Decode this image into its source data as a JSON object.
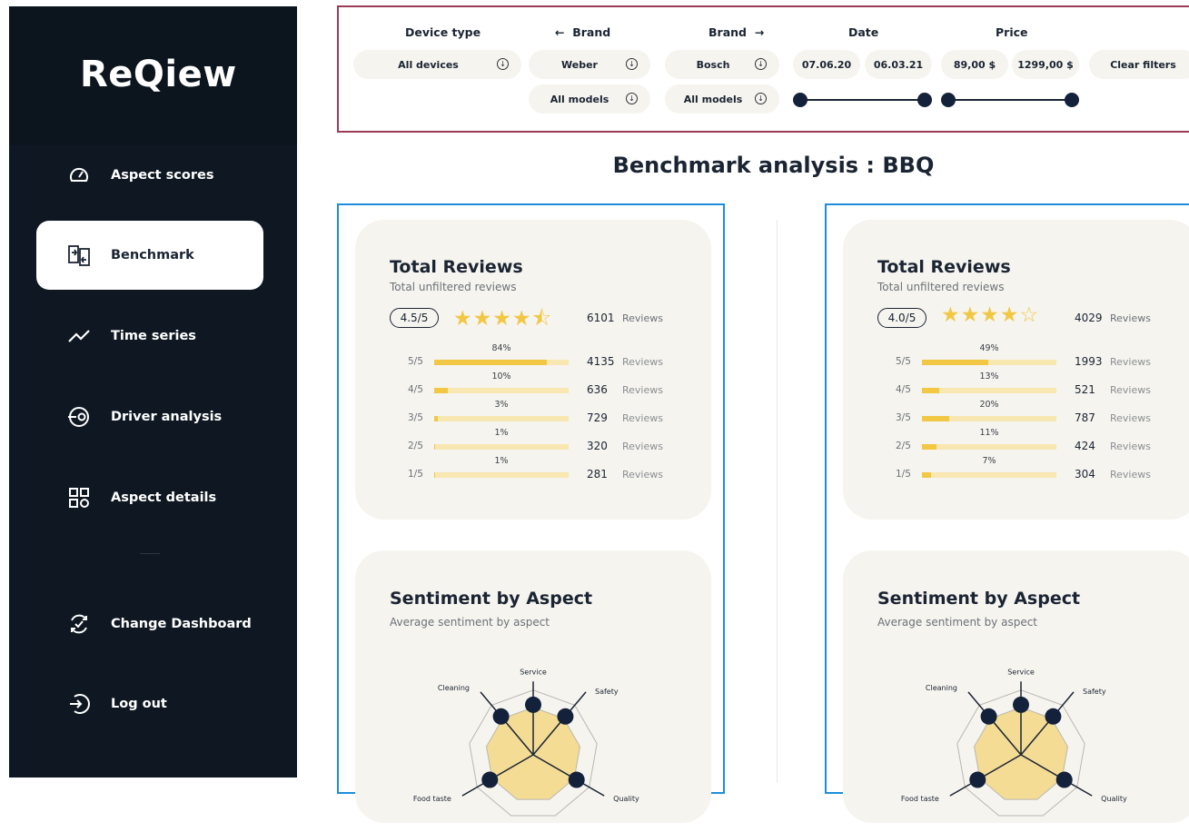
{
  "app": {
    "name": "ReQiew"
  },
  "sidebar": {
    "items": [
      {
        "label": "Aspect scores",
        "icon": "gauge-icon",
        "active": false
      },
      {
        "label": "Benchmark",
        "icon": "compare-icon",
        "active": true
      },
      {
        "label": "Time series",
        "icon": "trend-line-icon",
        "active": false
      },
      {
        "label": "Driver analysis",
        "icon": "target-icon",
        "active": false
      },
      {
        "label": "Aspect details",
        "icon": "grid-icon",
        "active": false
      }
    ],
    "bottom_items": [
      {
        "label": "Change Dashboard",
        "icon": "sync-icon"
      },
      {
        "label": "Log out",
        "icon": "logout-icon"
      }
    ]
  },
  "filters": {
    "device_type": {
      "label": "Device type",
      "value": "All devices"
    },
    "brand_left": {
      "label": "Brand",
      "arrow": "←",
      "brand": "Weber",
      "model": "All models"
    },
    "brand_right": {
      "label": "Brand",
      "arrow": "→",
      "brand": "Bosch",
      "model": "All models"
    },
    "date": {
      "label": "Date",
      "from": "07.06.20",
      "to": "06.03.21"
    },
    "price": {
      "label": "Price",
      "from": "89,00 $",
      "to": "1299,00 $"
    },
    "clear_label": "Clear filters"
  },
  "page": {
    "title": "Benchmark analysis : BBQ"
  },
  "panels": [
    {
      "total_reviews": {
        "title": "Total Reviews",
        "subtitle": "Total unfiltered reviews",
        "score": "4.5/5",
        "stars": "★★★★⯪",
        "rating": 4.5,
        "total": "6101",
        "total_label": "Reviews",
        "rows": [
          {
            "level": "5/5",
            "pct": "84%",
            "fraction": 0.84,
            "count": "4135",
            "label": "Reviews"
          },
          {
            "level": "4/5",
            "pct": "10%",
            "fraction": 0.1,
            "count": "636",
            "label": "Reviews"
          },
          {
            "level": "3/5",
            "pct": "3%",
            "fraction": 0.03,
            "count": "729",
            "label": "Reviews"
          },
          {
            "level": "2/5",
            "pct": "1%",
            "fraction": 0.01,
            "count": "320",
            "label": "Reviews"
          },
          {
            "level": "1/5",
            "pct": "1%",
            "fraction": 0.01,
            "count": "281",
            "label": "Reviews"
          }
        ]
      },
      "sentiment": {
        "title": "Sentiment by Aspect",
        "subtitle": "Average sentiment by aspect",
        "aspects": [
          "Service",
          "Safety",
          "Quality",
          "Food taste",
          "Cleaning"
        ]
      }
    },
    {
      "total_reviews": {
        "title": "Total Reviews",
        "subtitle": "Total unfiltered reviews",
        "score": "4.0/5",
        "stars": "★★★★☆",
        "rating": 4.0,
        "total": "4029",
        "total_label": "Reviews",
        "rows": [
          {
            "level": "5/5",
            "pct": "49%",
            "fraction": 0.49,
            "count": "1993",
            "label": "Reviews"
          },
          {
            "level": "4/5",
            "pct": "13%",
            "fraction": 0.13,
            "count": "521",
            "label": "Reviews"
          },
          {
            "level": "3/5",
            "pct": "20%",
            "fraction": 0.2,
            "count": "787",
            "label": "Reviews"
          },
          {
            "level": "2/5",
            "pct": "11%",
            "fraction": 0.11,
            "count": "424",
            "label": "Reviews"
          },
          {
            "level": "1/5",
            "pct": "7%",
            "fraction": 0.07,
            "count": "304",
            "label": "Reviews"
          }
        ]
      },
      "sentiment": {
        "title": "Sentiment by Aspect",
        "subtitle": "Average sentiment by aspect",
        "aspects": [
          "Service",
          "Safety",
          "Quality",
          "Food taste",
          "Cleaning"
        ]
      }
    }
  ],
  "colors": {
    "sidebar_bg": "#0f1822",
    "accent_star": "#f2c744",
    "filters_border": "#9a3c55",
    "panel_border": "#1c8edd"
  }
}
